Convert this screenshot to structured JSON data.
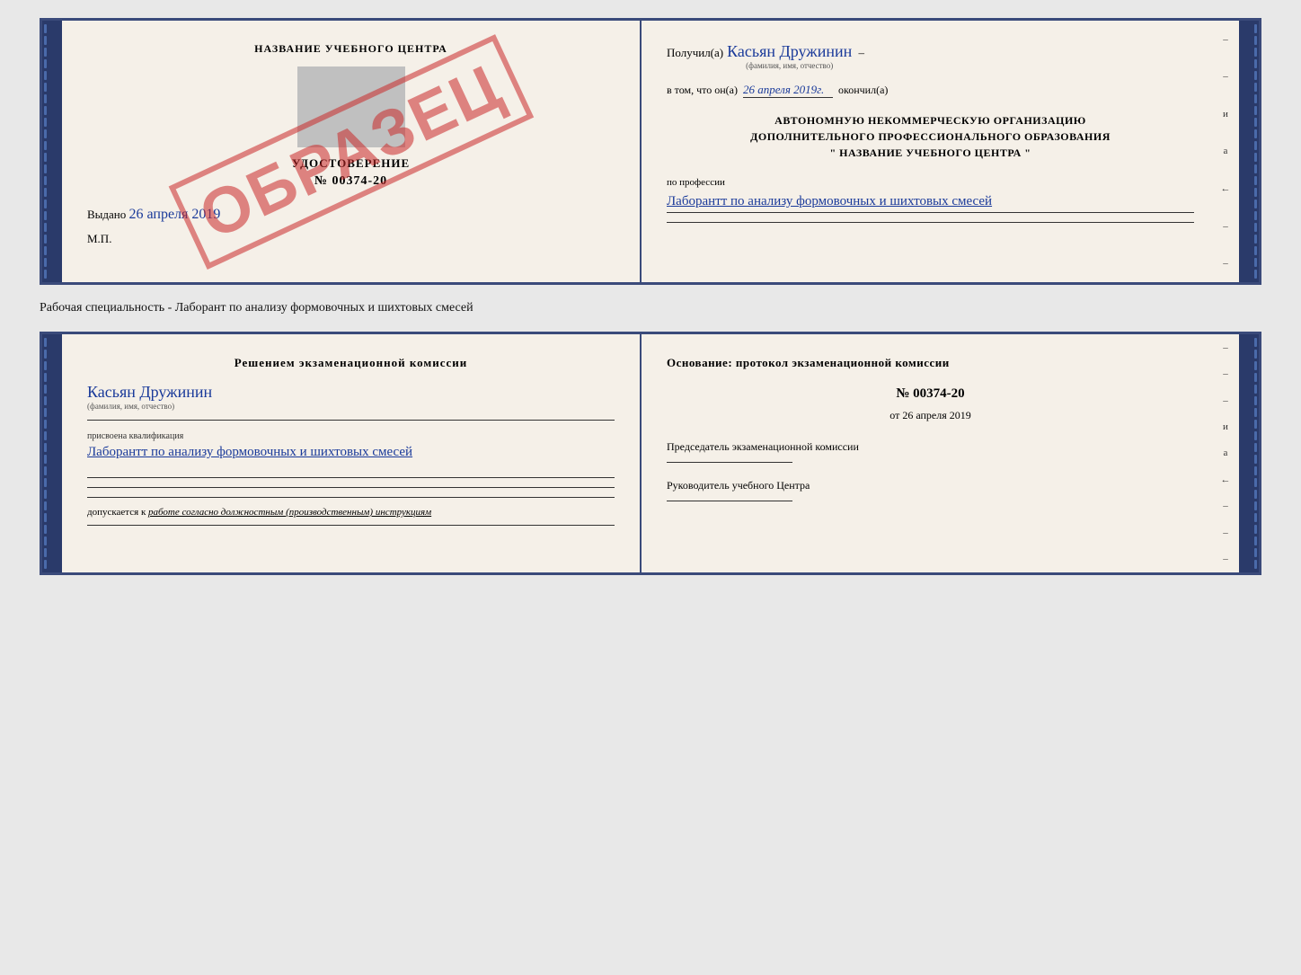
{
  "doc1": {
    "left": {
      "header": "НАЗВАНИЕ УЧЕБНОГО ЦЕНТРА",
      "stamp": "ОБРАЗЕЦ",
      "udost_title": "УДОСТОВЕРЕНИЕ",
      "udost_number": "№ 00374-20",
      "vydano_prefix": "Выдано",
      "vydano_date": "26 апреля 2019",
      "mp": "М.П."
    },
    "right": {
      "poluchil_prefix": "Получил(а)",
      "poluchil_name": "Касьян Дружинин",
      "fio_subtitle": "(фамилия, имя, отчество)",
      "vtom_prefix": "в том, что он(а)",
      "vtom_date": "26 апреля 2019г.",
      "okonchil": "окончил(а)",
      "org_line1": "АВТОНОМНУЮ НЕКОММЕРЧЕСКУЮ ОРГАНИЗАЦИЮ",
      "org_line2": "ДОПОЛНИТЕЛЬНОГО ПРОФЕССИОНАЛЬНОГО ОБРАЗОВАНИЯ",
      "org_line3": "\"  НАЗВАНИЕ УЧЕБНОГО ЦЕНТРА  \"",
      "po_professii": "по профессии",
      "professiya": "Лаборантт по анализу формовочных и шихтовых смесей",
      "markers": [
        "–",
        "–",
        "и",
        "а",
        "←",
        "–",
        "–"
      ]
    }
  },
  "subtitle": "Рабочая специальность - Лаборант по анализу формовочных и шихтовых смесей",
  "doc2": {
    "left": {
      "commission_title": "Решением экзаменационной комиссии",
      "fio_name": "Касьян Дружинин",
      "fio_subtitle": "(фамилия, имя, отчество)",
      "prisvoena_label": "присвоена квалификация",
      "kvali": "Лаборантт по анализу формовочных и шихтовых смесей",
      "dopuskaetsya_prefix": "допускается к",
      "dopuskaetsya_val": "работе согласно должностным (производственным) инструкциям"
    },
    "right": {
      "osnov_title": "Основание: протокол экзаменационной комиссии",
      "number": "№ 00374-20",
      "ot_prefix": "от",
      "ot_date": "26 апреля 2019",
      "predsedatel_title": "Председатель экзаменационной комиссии",
      "rukov_title": "Руководитель учебного Центра",
      "markers": [
        "–",
        "–",
        "–",
        "и",
        "а",
        "←",
        "–",
        "–",
        "–"
      ]
    }
  }
}
